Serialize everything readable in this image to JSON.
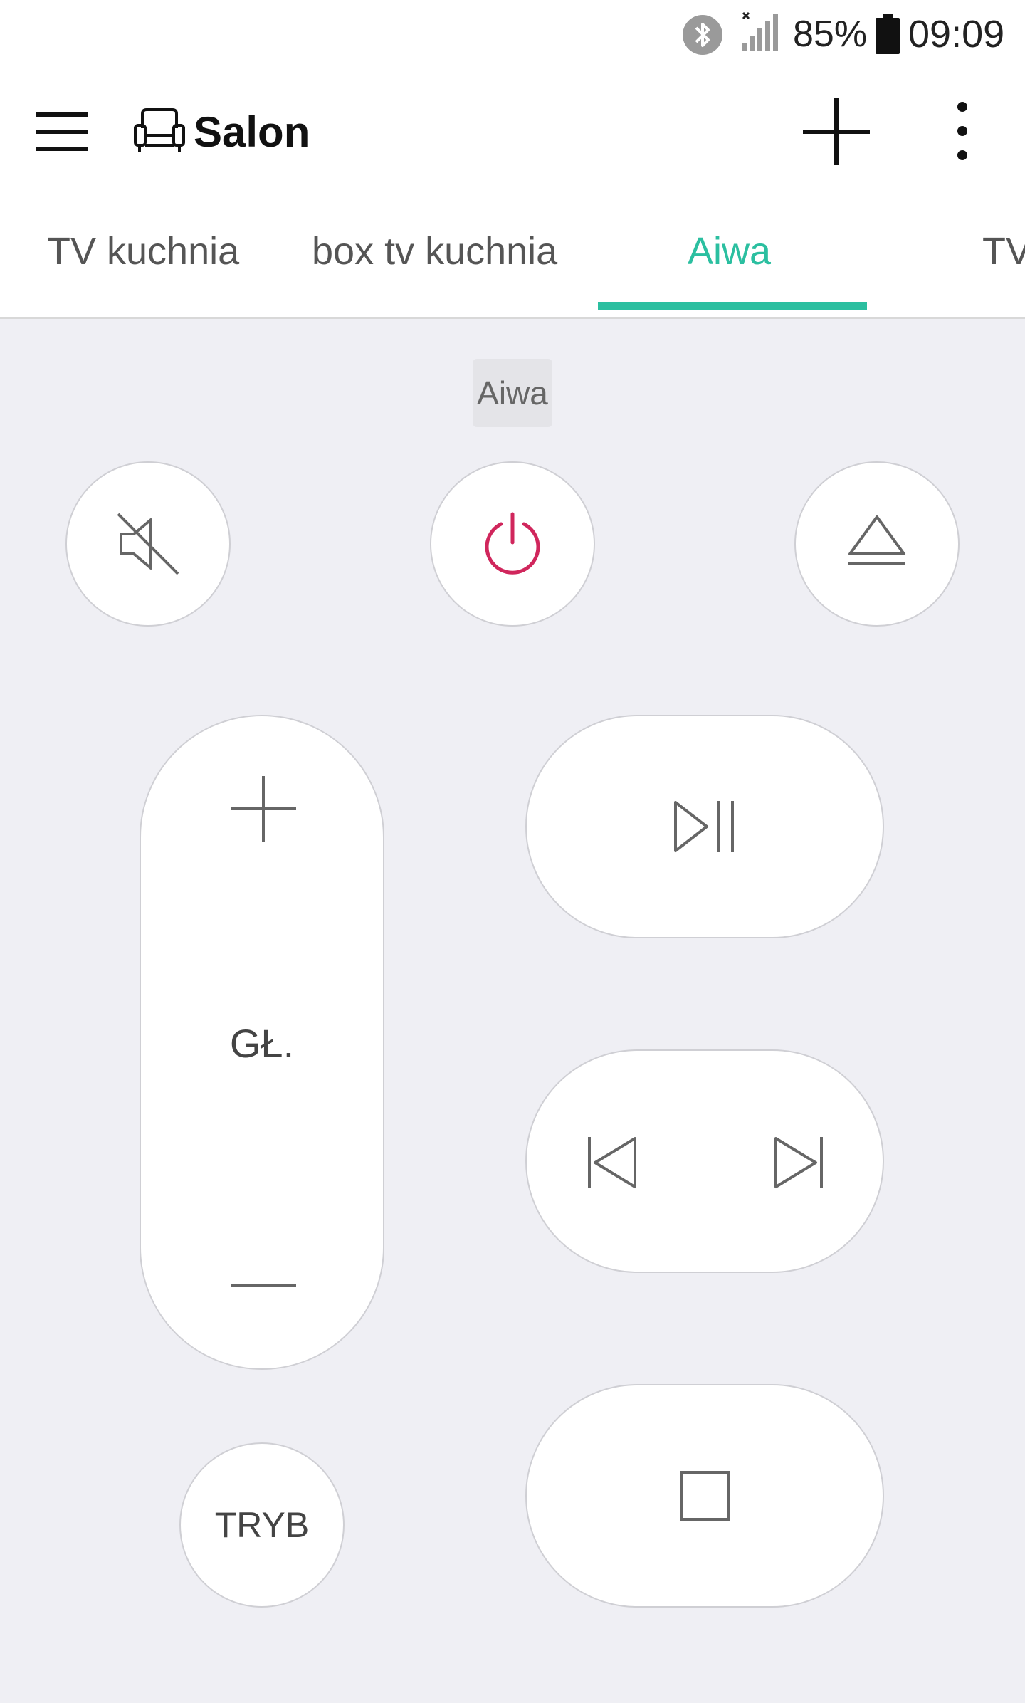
{
  "status_bar": {
    "battery_percent": "85%",
    "time": "09:09",
    "icons": [
      "bluetooth-icon",
      "signal-icon",
      "battery-icon"
    ]
  },
  "app_bar": {
    "room_title": "Salon",
    "icons": [
      "menu-icon",
      "sofa-icon",
      "plus-icon",
      "more-vertical-icon"
    ]
  },
  "tabs": [
    {
      "label": "TV kuchnia",
      "active": false
    },
    {
      "label": "box tv kuchnia",
      "active": false
    },
    {
      "label": "Aiwa",
      "active": true
    },
    {
      "label": "TV",
      "active": false
    }
  ],
  "device": {
    "name": "Aiwa"
  },
  "remote": {
    "volume_label": "GŁ.",
    "mode_label": "TRYB",
    "icons": [
      "mute-icon",
      "power-icon",
      "eject-icon",
      "plus-icon",
      "minus-icon",
      "play-pause-icon",
      "previous-icon",
      "next-icon",
      "stop-icon"
    ]
  },
  "colors": {
    "accent": "#2bbfa0",
    "power": "#d0265c",
    "background": "#efeff4",
    "icon": "#666666"
  }
}
